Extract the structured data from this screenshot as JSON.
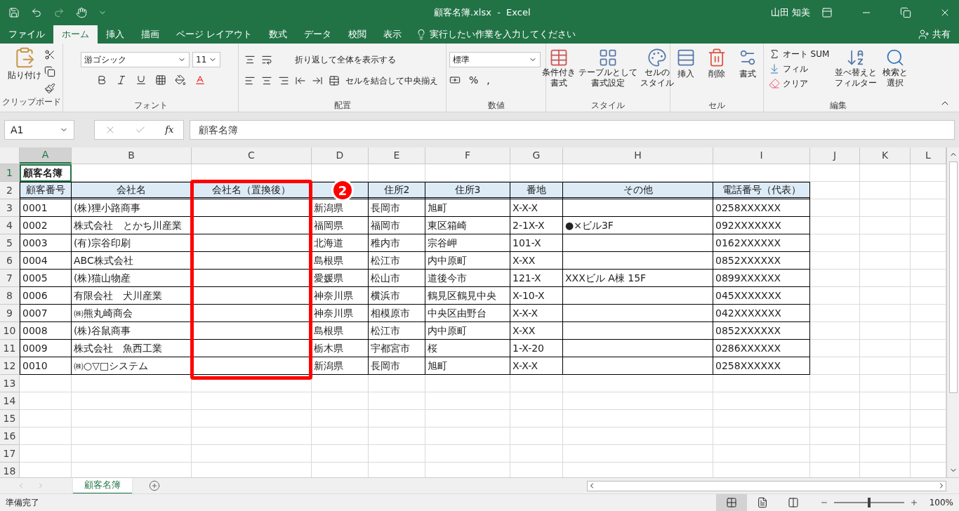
{
  "title_bar": {
    "title": "顧客名簿.xlsx  -  Excel",
    "user": "山田 知美"
  },
  "ribbon_tabs": [
    {
      "label": "ファイル",
      "selected": false
    },
    {
      "label": "ホーム",
      "selected": true
    },
    {
      "label": "挿入",
      "selected": false
    },
    {
      "label": "描画",
      "selected": false
    },
    {
      "label": "ページ レイアウト",
      "selected": false
    },
    {
      "label": "数式",
      "selected": false
    },
    {
      "label": "データ",
      "selected": false
    },
    {
      "label": "校閲",
      "selected": false
    },
    {
      "label": "表示",
      "selected": false
    }
  ],
  "tell_me": "実行したい作業を入力してください",
  "share": "共有",
  "ribbon": {
    "clipboard": {
      "paste": "貼り付け",
      "label": "クリップボード"
    },
    "font": {
      "font_name": "游ゴシック",
      "font_size": "11",
      "label": "フォント"
    },
    "alignment": {
      "wrap": "折り返して全体を表示する",
      "merge": "セルを結合して中央揃え",
      "label": "配置"
    },
    "number": {
      "format": "標準",
      "percent": "%",
      "comma": ",",
      "label": "数値"
    },
    "styles": {
      "buttons": [
        [
          "条件付き",
          "書式"
        ],
        [
          "テーブルとして",
          "書式設定"
        ],
        [
          "セルの",
          "スタイル"
        ]
      ],
      "label": "スタイル"
    },
    "cells": {
      "buttons": [
        "挿入",
        "削除",
        "書式"
      ],
      "label": "セル"
    },
    "editing": {
      "autosum": "オート SUM",
      "fill": "フィル",
      "clear": "クリア",
      "sort": [
        "並べ替えと",
        "フィルター"
      ],
      "find": [
        "検索と",
        "選択"
      ],
      "label": "編集"
    }
  },
  "formula_bar": {
    "name_box": "A1",
    "fx": "fx",
    "content": "顧客名簿"
  },
  "columns": [
    {
      "label": "A",
      "selected": true
    },
    {
      "label": "B",
      "selected": false
    },
    {
      "label": "C",
      "selected": false
    },
    {
      "label": "D",
      "selected": false
    },
    {
      "label": "E",
      "selected": false
    },
    {
      "label": "F",
      "selected": false
    },
    {
      "label": "G",
      "selected": false
    },
    {
      "label": "H",
      "selected": false
    },
    {
      "label": "I",
      "selected": false
    },
    {
      "label": "J",
      "selected": false
    },
    {
      "label": "K",
      "selected": false
    },
    {
      "label": "L",
      "selected": false
    }
  ],
  "rows": [
    {
      "label": "1",
      "selected": true
    },
    {
      "label": "2",
      "selected": false
    },
    {
      "label": "3",
      "selected": false
    },
    {
      "label": "4",
      "selected": false
    },
    {
      "label": "5",
      "selected": false
    },
    {
      "label": "6",
      "selected": false
    },
    {
      "label": "7",
      "selected": false
    },
    {
      "label": "8",
      "selected": false
    },
    {
      "label": "9",
      "selected": false
    },
    {
      "label": "10",
      "selected": false
    },
    {
      "label": "11",
      "selected": false
    },
    {
      "label": "12",
      "selected": false
    },
    {
      "label": "13",
      "selected": false
    },
    {
      "label": "14",
      "selected": false
    },
    {
      "label": "15",
      "selected": false
    },
    {
      "label": "16",
      "selected": false
    },
    {
      "label": "17",
      "selected": false
    },
    {
      "label": "18",
      "selected": false
    }
  ],
  "sheet_title": "顧客名簿",
  "headers": [
    "顧客番号",
    "会社名",
    "会社名（置換後）",
    "住所2",
    "住所3",
    "番地",
    "その他",
    "電話番号（代表）"
  ],
  "records": [
    {
      "id": "0001",
      "company": "(株)狸小路商事",
      "pref": "新潟県",
      "city": "長岡市",
      "town": "旭町",
      "number": "X-X-X",
      "phone": "0258XXXXXX"
    },
    {
      "id": "0002",
      "company": "株式会社　とかち川産業",
      "pref": "福岡県",
      "city": "福岡市",
      "town": "東区箱崎",
      "number": "2-1X-X",
      "other": "●×ビル3F",
      "phone": "092XXXXXXX"
    },
    {
      "id": "0003",
      "company": "(有)宗谷印刷",
      "pref": "北海道",
      "city": "稚内市",
      "town": "宗谷岬",
      "number": "101-X",
      "phone": "0162XXXXXX"
    },
    {
      "id": "0004",
      "company": "ABC株式会社",
      "pref": "島根県",
      "city": "松江市",
      "town": "内中原町",
      "number": "X-XX",
      "phone": "0852XXXXXX"
    },
    {
      "id": "0005",
      "company": "(株)猫山物産",
      "pref": "愛媛県",
      "city": "松山市",
      "town": "道後今市",
      "number": "121-X",
      "other": "XXXビル A棟 15F",
      "phone": "0899XXXXXX"
    },
    {
      "id": "0006",
      "company": "有限会社　犬川産業",
      "pref": "神奈川県",
      "city": "横浜市",
      "town": "鶴見区鶴見中央",
      "number": "X-10-X",
      "phone": "045XXXXXXX"
    },
    {
      "id": "0007",
      "company": "㈱熊丸崎商会",
      "pref": "神奈川県",
      "city": "相模原市",
      "town": "中央区由野台",
      "number": "X-X-X",
      "phone": "042XXXXXXX"
    },
    {
      "id": "0008",
      "company": "(株)谷鼠商事",
      "pref": "島根県",
      "city": "松江市",
      "town": "内中原町",
      "number": "X-XX",
      "phone": "0852XXXXXX"
    },
    {
      "id": "0009",
      "company": "株式会社　魚西工業",
      "pref": "栃木県",
      "city": "宇都宮市",
      "town": "桜",
      "number": "1-X-20",
      "phone": "0286XXXXXX"
    },
    {
      "id": "0010",
      "company": "㈱○▽□システム",
      "pref": "新潟県",
      "city": "長岡市",
      "town": "旭町",
      "number": "X-X-X",
      "phone": "0258XXXXXX"
    }
  ],
  "annotation": {
    "badge": "2"
  },
  "sheet_tabs": [
    {
      "label": "顧客名簿",
      "selected": true
    }
  ],
  "status_bar": {
    "ready": "準備完了",
    "views": [
      {
        "selected": true
      },
      {
        "selected": false
      },
      {
        "selected": false
      }
    ],
    "zoom_slider": {
      "level": 0.5
    },
    "zoom": "100%"
  }
}
